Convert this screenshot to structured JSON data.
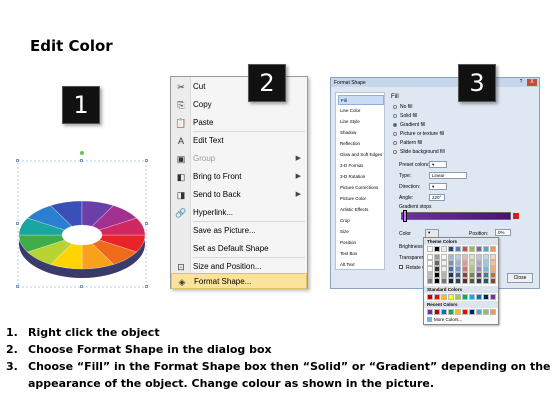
{
  "title": "Edit Color",
  "badges": [
    "1",
    "2",
    "3"
  ],
  "context_menu": {
    "items": [
      {
        "label": "Cut",
        "icon": "scissors-icon",
        "glyph": "✂",
        "disabled": false,
        "submenu": false
      },
      {
        "label": "Copy",
        "icon": "copy-icon",
        "glyph": "⎘",
        "disabled": false,
        "submenu": false
      },
      {
        "label": "Paste",
        "icon": "paste-icon",
        "glyph": "📋",
        "disabled": false,
        "submenu": false
      },
      {
        "label": "Edit Text",
        "icon": "edit-text-icon",
        "glyph": "A",
        "disabled": false,
        "submenu": false
      },
      {
        "label": "Group",
        "icon": "group-icon",
        "glyph": "▣",
        "disabled": true,
        "submenu": true
      },
      {
        "label": "Bring to Front",
        "icon": "bring-front-icon",
        "glyph": "◧",
        "disabled": false,
        "submenu": true
      },
      {
        "label": "Send to Back",
        "icon": "send-back-icon",
        "glyph": "◨",
        "disabled": false,
        "submenu": true
      },
      {
        "label": "Hyperlink...",
        "icon": "hyperlink-icon",
        "glyph": "🔗",
        "disabled": false,
        "submenu": false
      },
      {
        "label": "Save as Picture...",
        "icon": "",
        "glyph": "",
        "disabled": false,
        "submenu": false
      },
      {
        "label": "Set as Default Shape",
        "icon": "",
        "glyph": "",
        "disabled": false,
        "submenu": false
      },
      {
        "label": "Size and Position...",
        "icon": "size-position-icon",
        "glyph": "⊡",
        "disabled": false,
        "submenu": false
      },
      {
        "label": "Format Shape...",
        "icon": "format-shape-icon",
        "glyph": "◈",
        "disabled": false,
        "submenu": false,
        "highlighted": true
      }
    ]
  },
  "format_dialog": {
    "title": "Format Shape",
    "window_buttons": [
      "?",
      "X"
    ],
    "sidebar": [
      "Fill",
      "Line Color",
      "Line Style",
      "Shadow",
      "Reflection",
      "Glow and Soft Edges",
      "3-D Format",
      "3-D Rotation",
      "Picture Corrections",
      "Picture Color",
      "Artistic Effects",
      "Crop",
      "Size",
      "Position",
      "Text Box",
      "Alt Text"
    ],
    "section_title": "Fill",
    "fill_options": [
      "No fill",
      "Solid fill",
      "Gradient fill",
      "Picture or texture fill",
      "Pattern fill",
      "Slide background fill"
    ],
    "selected_fill": 2,
    "preset_label": "Preset colors:",
    "type_label": "Type:",
    "type_value": "Linear",
    "direction_label": "Direction:",
    "angle_label": "Angle:",
    "angle_value": "220°",
    "stops_label": "Gradient stops",
    "color_label": "Color",
    "position_label": "Position:",
    "position_value": "0%",
    "brightness_label": "Brightness",
    "transparency_label": "Transparency",
    "rotate_label": "Rotate with shape",
    "close_label": "Close",
    "palette": {
      "theme_header": "Theme Colors",
      "standard_header": "Standard Colors",
      "recent_header": "Recent Colors",
      "more_label": "More Colors...",
      "theme_top": [
        "#ffffff",
        "#000000",
        "#eeece1",
        "#1f497d",
        "#4f81bd",
        "#c0504d",
        "#9bbb59",
        "#8064a2",
        "#4bacc6",
        "#f79646"
      ],
      "standard": [
        "#c00000",
        "#ff0000",
        "#ffc000",
        "#ffff00",
        "#92d050",
        "#00b050",
        "#00b0f0",
        "#0070c0",
        "#002060",
        "#7030a0"
      ],
      "recent": [
        "#7030a0",
        "#c00000",
        "#0070c0",
        "#00b050",
        "#ffc000",
        "#ff0000",
        "#002060",
        "#4bacc6",
        "#9bbb59",
        "#f79646"
      ]
    }
  },
  "steps": [
    {
      "n": "1.",
      "text": "Right click the object"
    },
    {
      "n": "2.",
      "text": "Choose Format Shape in the dialog box"
    },
    {
      "n": "3.",
      "text": "Choose “Fill” in the Format Shape box then “Solid” or “Gradient” depending on the appearance of the object. Change colour as shown in the picture."
    }
  ]
}
